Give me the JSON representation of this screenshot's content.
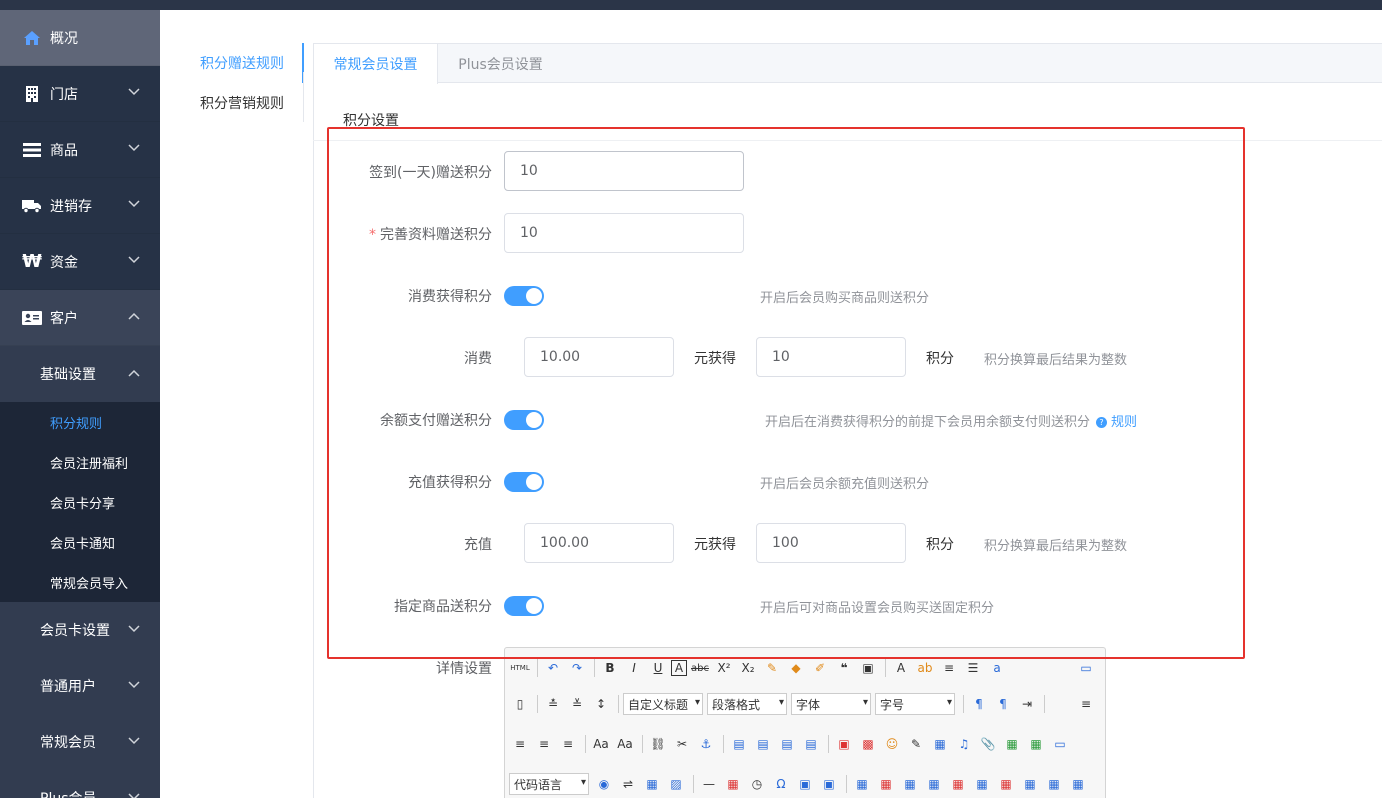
{
  "sidebar": {
    "home": "概况",
    "store": "门店",
    "goods": "商品",
    "inventory": "进销存",
    "finance": "资金",
    "customer": "客户",
    "basic_settings": "基础设置",
    "leaves": [
      "积分规则",
      "会员注册福利",
      "会员卡分享",
      "会员卡通知",
      "常规会员导入"
    ],
    "member_card_settings": "会员卡设置",
    "normal_users": "普通用户",
    "regular_members": "常规会员",
    "plus_members": "Plus会员"
  },
  "subnav": {
    "items": [
      "积分赠送规则",
      "积分营销规则"
    ]
  },
  "tabs": [
    "常规会员设置",
    "Plus会员设置"
  ],
  "section_title": "积分设置",
  "form": {
    "signin_label": "签到(一天)赠送积分",
    "signin_value": "10",
    "profile_label": "完善资料赠送积分",
    "profile_required": "*",
    "profile_value": "10",
    "consume_label": "消费获得积分",
    "consume_hint": "开启后会员购买商品则送积分",
    "consume_row_label": "消费",
    "consume_amount": "10.00",
    "consume_unit1": "元获得",
    "consume_points": "10",
    "consume_unit2": "积分",
    "consume_row_hint": "积分换算最后结果为整数",
    "balance_label": "余额支付赠送积分",
    "balance_hint": "开启后在消费获得积分的前提下会员用余额支付则送积分",
    "balance_rule_link": "规则",
    "recharge_label": "充值获得积分",
    "recharge_hint": "开启后会员余额充值则送积分",
    "recharge_row_label": "充值",
    "recharge_amount": "100.00",
    "recharge_unit1": "元获得",
    "recharge_points": "100",
    "recharge_unit2": "积分",
    "recharge_row_hint": "积分换算最后结果为整数",
    "goods_label": "指定商品送积分",
    "goods_hint": "开启后可对商品设置会员购买送固定积分",
    "detail_label": "详情设置"
  },
  "toggles": {
    "consume": true,
    "balance": true,
    "recharge": true,
    "goods": true
  },
  "editor": {
    "custom_title": "自定义标题",
    "paragraph": "段落格式",
    "font": "字体",
    "font_size": "字号",
    "code_lang": "代码语言"
  },
  "colors": {
    "accent": "#409eff",
    "sidebar_bg": "#263246",
    "highlight_box": "#e5322d"
  }
}
